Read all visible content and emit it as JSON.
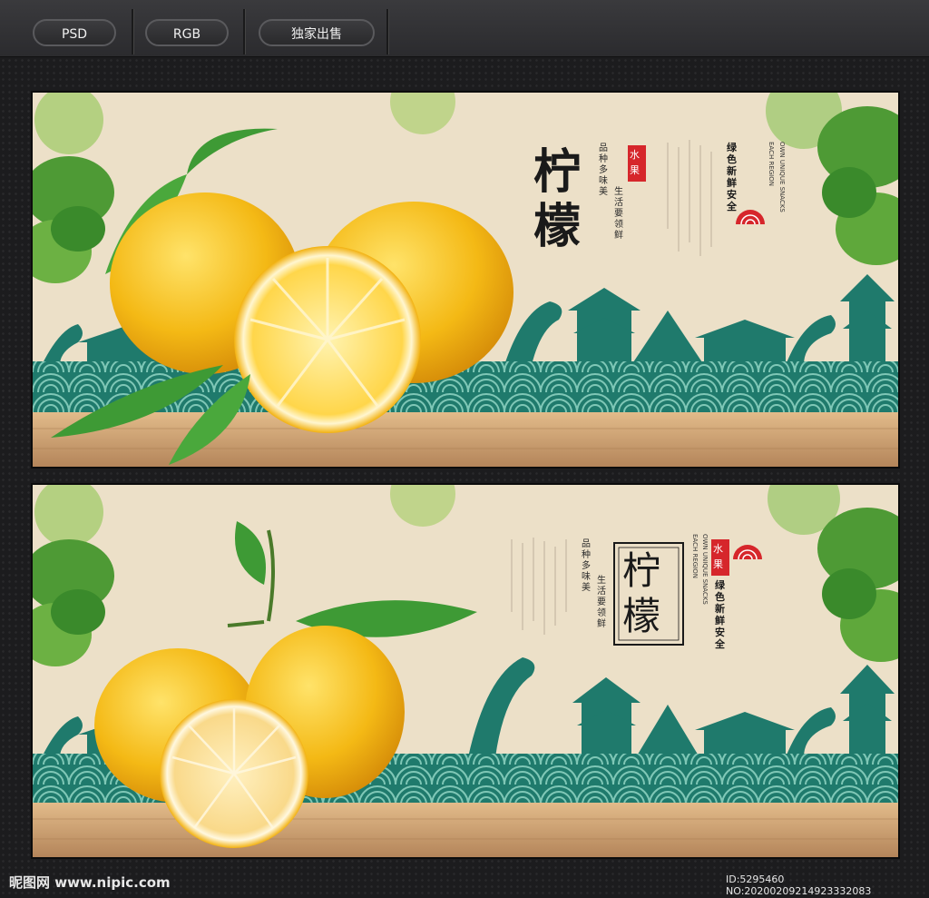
{
  "header": {
    "tags": [
      "PSD",
      "RGB",
      "独家出售"
    ]
  },
  "poster1": {
    "title_a": "柠",
    "title_b": "檬",
    "seal": "水果",
    "slogan_col1": "品种多味美",
    "slogan_col2": "生活要领鲜",
    "green_text": "绿色新鲜安全",
    "en_col1": "EACH REGION",
    "en_col2": "OWN UNIQUE SNACKS"
  },
  "poster2": {
    "title_a": "柠",
    "title_b": "檬",
    "seal": "水果",
    "slogan_col1": "品种多味美",
    "slogan_col2": "生活要领鲜",
    "green_text": "绿色新鲜安全",
    "en_col1": "EACH REGION",
    "en_col2": "OWN UNIQUE SNACKS"
  },
  "footer": {
    "brand": "昵图网 www.nipic.com",
    "id_text": "ID:5295460 NO:20200209214923332083"
  },
  "colors": {
    "background": "#1c1c1e",
    "paper": "#ece0c8",
    "teal": "#1f7a6c",
    "wood": "#c69b6d",
    "lemon": "#f4b915",
    "leaf": "#3e9a35",
    "seal_red": "#d6262b"
  }
}
